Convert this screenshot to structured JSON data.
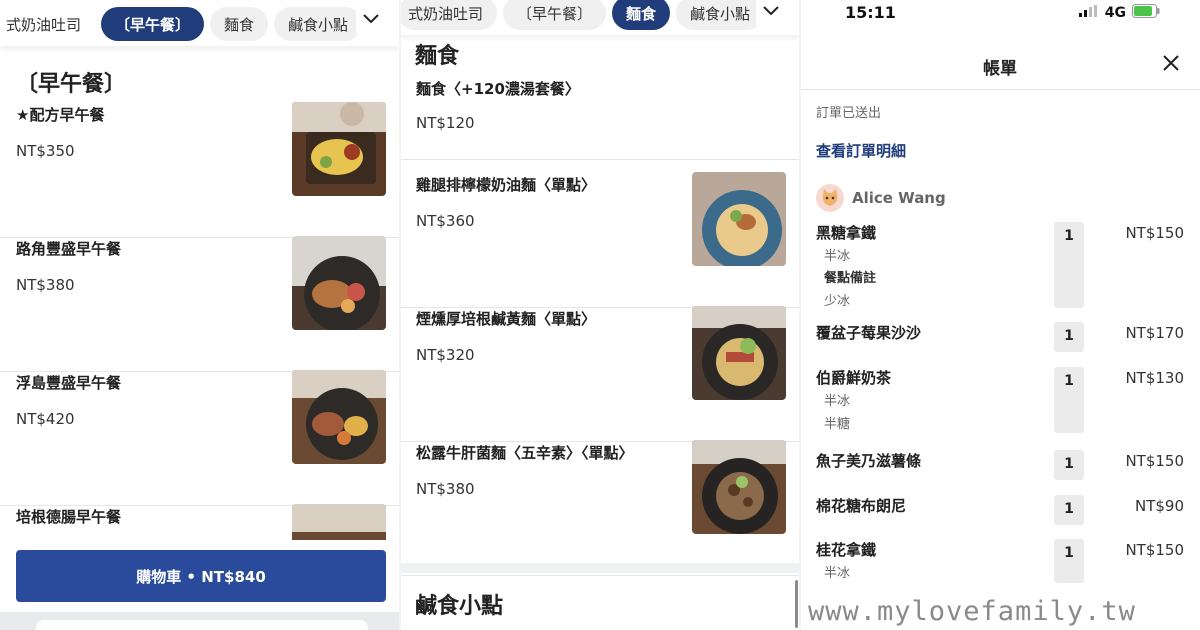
{
  "panel1": {
    "chips": [
      "式奶油吐司",
      "〔早午餐〕",
      "麵食",
      "鹹食小點"
    ],
    "active_chip": 1,
    "section_title": "〔早午餐〕",
    "items": [
      {
        "name": "★配方早午餐",
        "price": "NT$350"
      },
      {
        "name": "路角豐盛早午餐",
        "price": "NT$380"
      },
      {
        "name": "浮島豐盛早午餐",
        "price": "NT$420"
      },
      {
        "name": "培根德腸早午餐",
        "price": ""
      }
    ],
    "cart_label": "購物車 • NT$840"
  },
  "panel2": {
    "chips": [
      "式奶油吐司",
      "〔早午餐〕",
      "麵食",
      "鹹食小點"
    ],
    "active_chip": 2,
    "section_title": "麵食",
    "items": [
      {
        "name": "麵食〈+120濃湯套餐〉",
        "price": "NT$120"
      },
      {
        "name": "雞腿排檸檬奶油麵〈單點〉",
        "price": "NT$360"
      },
      {
        "name": "煙燻厚培根鹹黃麵〈單點〉",
        "price": "NT$320"
      },
      {
        "name": "松露牛肝菌麵〈五辛素〉〈單點〉",
        "price": "NT$380"
      }
    ],
    "next_section_title": "鹹食小點"
  },
  "panel3": {
    "time": "15:11",
    "network": "4G",
    "title": "帳單",
    "order_status": "訂單已送出",
    "order_link": "查看訂單明細",
    "user_name": "Alice Wang",
    "lines": [
      {
        "name": "黑糖拿鐵",
        "qty": "1",
        "price": "NT$150",
        "subs": [
          {
            "text": "半冰",
            "bold": false
          },
          {
            "text": "餐點備註",
            "bold": true
          },
          {
            "text": "少冰",
            "bold": false
          }
        ]
      },
      {
        "name": "覆盆子莓果沙沙",
        "qty": "1",
        "price": "NT$170",
        "subs": []
      },
      {
        "name": "伯爵鮮奶茶",
        "qty": "1",
        "price": "NT$130",
        "subs": [
          {
            "text": "半冰",
            "bold": false
          },
          {
            "text": "半糖",
            "bold": false
          }
        ]
      },
      {
        "name": "魚子美乃滋薯條",
        "qty": "1",
        "price": "NT$150",
        "subs": []
      },
      {
        "name": "棉花糖布朗尼",
        "qty": "1",
        "price": "NT$90",
        "subs": []
      },
      {
        "name": "桂花拿鐵",
        "qty": "1",
        "price": "NT$150",
        "subs": [
          {
            "text": "半冰",
            "bold": false
          }
        ]
      }
    ]
  },
  "watermark": "www.mylovefamily.tw",
  "colors": {
    "brand_navy": "#213c7a",
    "cart_blue": "#2a4b9b",
    "chip_bg": "#f0f0f0"
  },
  "icons": {
    "chevron": "chevron-down-icon",
    "close": "close-icon",
    "avatar": "cat-avatar-icon"
  }
}
